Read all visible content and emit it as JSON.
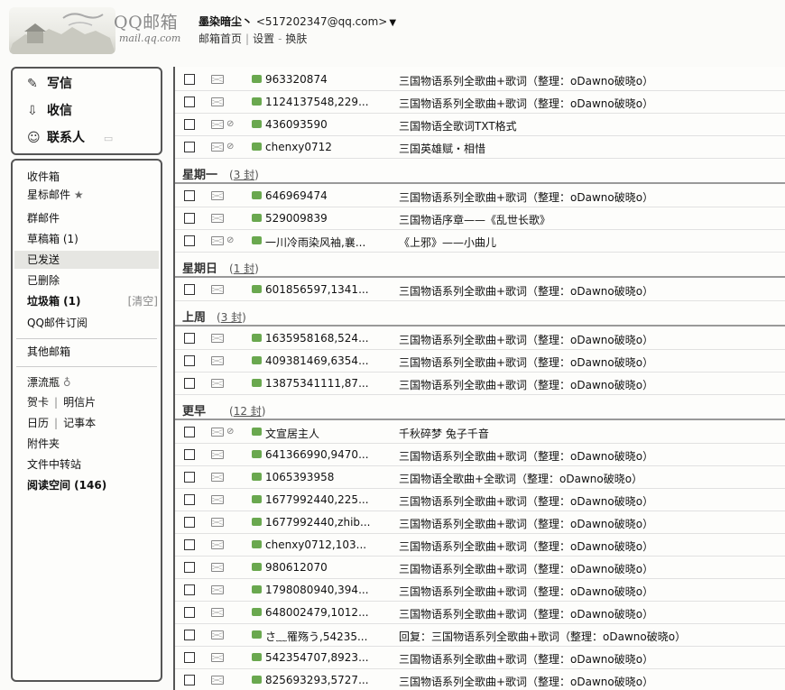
{
  "header": {
    "logo_text": "QQ邮箱",
    "logo_sub": "mail.qq.com",
    "user_name": "墨染暗尘丶",
    "user_email": "<517202347@qq.com>",
    "links": [
      "邮箱首页",
      "设置",
      "换肤"
    ]
  },
  "sidebar_top": [
    {
      "label": "写信",
      "icon": "pencil-icon"
    },
    {
      "label": "收信",
      "icon": "inbox-arrow-icon"
    },
    {
      "label": "联系人",
      "icon": "contacts-icon"
    }
  ],
  "folders": {
    "inbox": "收件箱",
    "starred": "星标邮件",
    "group": "群邮件",
    "drafts": "草稿箱 (1)",
    "sent": "已发送",
    "deleted": "已删除",
    "spam": "垃圾箱 (1)",
    "spam_clear": "[清空]",
    "subscriptions": "QQ邮件订阅",
    "other_mail": "其他邮箱",
    "drift_bottle": "漂流瓶",
    "cards": "贺卡",
    "postcards": "明信片",
    "calendar": "日历",
    "notes": "记事本",
    "attachments": "附件夹",
    "transfer": "文件中转站",
    "reading": "阅读空间 (146)"
  },
  "groups": [
    {
      "name": "星期一",
      "count": "3 封"
    },
    {
      "name": "星期日",
      "count": "1 封"
    },
    {
      "name": "上周",
      "count": "3 封"
    },
    {
      "name": "更早",
      "count": "12 封"
    }
  ],
  "emails": [
    {
      "sender": "963320874",
      "subject": "三国物语系列全歌曲+歌词（整理：oDawno破晓o）",
      "clip": false
    },
    {
      "sender": "1124137548,229...",
      "subject": "三国物语系列全歌曲+歌词（整理：oDawno破晓o）",
      "clip": false
    },
    {
      "sender": "436093590",
      "subject": "三国物语全歌词TXT格式",
      "clip": true
    },
    {
      "sender": "chenxy0712",
      "subject": "三国英雄赋・相惜",
      "clip": true
    },
    {
      "sender": "646969474",
      "subject": "三国物语系列全歌曲+歌词（整理：oDawno破晓o）",
      "clip": false
    },
    {
      "sender": "529009839",
      "subject": "三国物语序章——《乱世长歌》",
      "clip": false
    },
    {
      "sender": "一川冷雨染风袖,襄...",
      "subject": "《上邪》——小曲儿",
      "clip": true
    },
    {
      "sender": "601856597,1341...",
      "subject": "三国物语系列全歌曲+歌词（整理：oDawno破晓o）",
      "clip": false
    },
    {
      "sender": "1635958168,524...",
      "subject": "三国物语系列全歌曲+歌词（整理：oDawno破晓o）",
      "clip": false
    },
    {
      "sender": "409381469,6354...",
      "subject": "三国物语系列全歌曲+歌词（整理：oDawno破晓o）",
      "clip": false
    },
    {
      "sender": "13875341111,87...",
      "subject": "三国物语系列全歌曲+歌词（整理：oDawno破晓o）",
      "clip": false
    },
    {
      "sender": "文宣居主人",
      "subject": "千秋碎梦  兔子千音",
      "clip": true
    },
    {
      "sender": "641366990,9470...",
      "subject": "三国物语系列全歌曲+歌词（整理：oDawno破晓o）",
      "clip": false
    },
    {
      "sender": "1065393958",
      "subject": "三国物语全歌曲+全歌词（整理：oDawno破晓o）",
      "clip": false
    },
    {
      "sender": "1677992440,225...",
      "subject": "三国物语系列全歌曲+歌词（整理：oDawno破晓o）",
      "clip": false
    },
    {
      "sender": "1677992440,zhib...",
      "subject": "三国物语系列全歌曲+歌词（整理：oDawno破晓o）",
      "clip": false
    },
    {
      "sender": "chenxy0712,103...",
      "subject": "三国物语系列全歌曲+歌词（整理：oDawno破晓o）",
      "clip": false
    },
    {
      "sender": "980612070",
      "subject": "三国物语系列全歌曲+歌词（整理：oDawno破晓o）",
      "clip": false
    },
    {
      "sender": "1798080940,394...",
      "subject": "三国物语系列全歌曲+歌词（整理：oDawno破晓o）",
      "clip": false
    },
    {
      "sender": "648002479,1012...",
      "subject": "三国物语系列全歌曲+歌词（整理：oDawno破晓o）",
      "clip": false
    },
    {
      "sender": "さ﹏罹殇う,54235...",
      "subject": "回复：三国物语系列全歌曲+歌词（整理：oDawno破晓o）",
      "clip": false
    },
    {
      "sender": "542354707,8923...",
      "subject": "三国物语系列全歌曲+歌词（整理：oDawno破晓o）",
      "clip": false
    },
    {
      "sender": "825693293,5727...",
      "subject": "三国物语系列全歌曲+歌词（整理：oDawno破晓o）",
      "clip": false
    }
  ]
}
